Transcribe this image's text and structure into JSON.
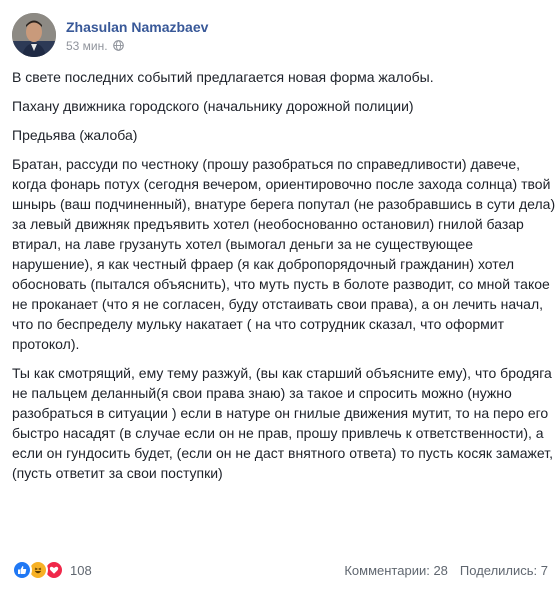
{
  "post": {
    "author": "Zhasulan Namazbaev",
    "time": "53 мин.",
    "privacy_icon": "globe-icon",
    "paragraphs": [
      "В свете последних событий предлагается новая форма жалобы.",
      "Пахану движника городского (начальнику дорожной полиции)",
      "Предьява (жалоба)",
      "Братан, рассуди по честноку (прошу разобраться по справедливости) давече, когда фонарь потух (сегодня вечером, ориентировочно после захода солнца) твой шныpь (ваш подчиненный), внатуре берега попутал (не разобравшись в сути дела) за левый движняк предъявить хотел (необоснованно остановил) гнилой базар втирал, на лаве грузануть хотел (вымогал деньги за не существующее нарушение), я как честный фраер (я как добропорядочный гражданин) хотел обосновать (пытался объяснить), что муть пусть в болоте разводит, со мной такое не проканает (что я не согласен, буду отстаивать свои права), а он лечить начал, что по беспределу мульку накатает ( на что сотрудник сказал, что оформит протокол).",
      "Ты как смотрящий, ему тему разжуй, (вы как старший объясните ему), что бродяга не пальцем деланный(я свои права знаю) за такое и спросить можно (нужно разобраться в ситуации ) если в натуре он гнилые движения мутит, то на перо его быстро насадят (в случае если он не прав, прошу привлечь к ответственности), а если он гундосить будет, (если он не даст внятного ответа) то пусть косяк замажет, (пусть ответит за свои поступки)"
    ]
  },
  "footer": {
    "reaction_icons": [
      "like-icon",
      "haha-icon",
      "love-icon"
    ],
    "reaction_count": "108",
    "comments": "Комментарии: 28",
    "shares": "Поделились: 7"
  },
  "colors": {
    "author": "#385898",
    "meta": "#90949c",
    "like": "#2078f4",
    "haha": "#f7b125",
    "love": "#f0284a"
  }
}
